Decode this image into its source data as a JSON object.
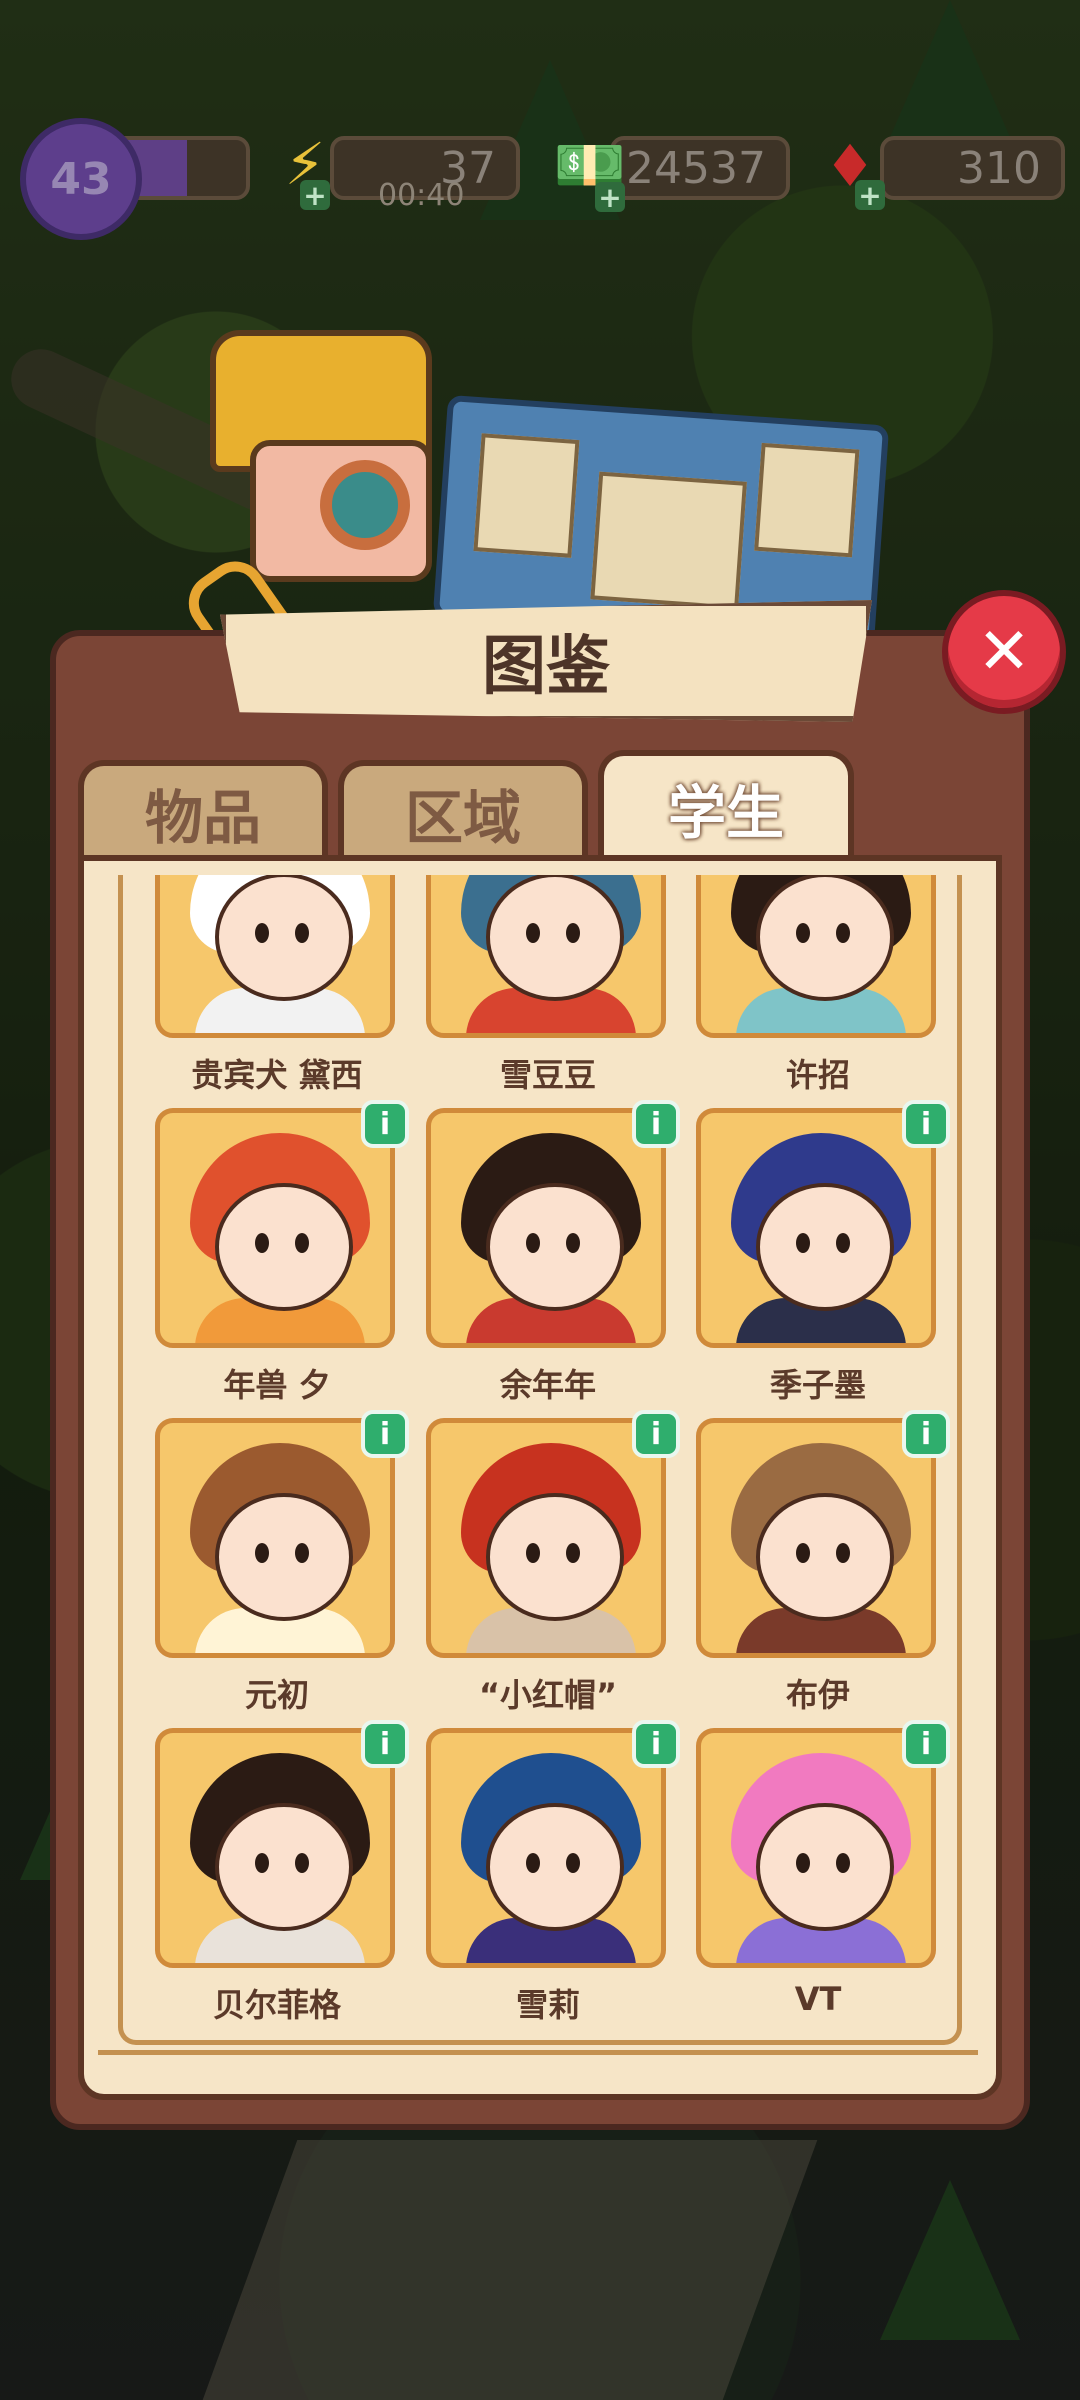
{
  "hud": {
    "level": "43",
    "xp_progress": 0.55,
    "energy": "37",
    "energy_timer": "00:40",
    "cash": "24537",
    "gems": "310"
  },
  "panel": {
    "title": "图鉴",
    "tabs": [
      {
        "label": "物品",
        "active": false
      },
      {
        "label": "区域",
        "active": false
      },
      {
        "label": "学生",
        "active": true
      }
    ]
  },
  "students": [
    {
      "name": "贵宾犬 黛西",
      "has_info": false,
      "hair": "#ffffff",
      "body": "#f2f2f2"
    },
    {
      "name": "雪豆豆",
      "has_info": false,
      "hair": "#3b6f8f",
      "body": "#d8442f"
    },
    {
      "name": "许招",
      "has_info": false,
      "hair": "#2b1b14",
      "body": "#7fc4c8"
    },
    {
      "name": "年兽 夕",
      "has_info": true,
      "hair": "#e0512d",
      "body": "#f19a3a"
    },
    {
      "name": "余年年",
      "has_info": true,
      "hair": "#2b1b14",
      "body": "#c93a2f"
    },
    {
      "name": "季子墨",
      "has_info": true,
      "hair": "#2f3a8c",
      "body": "#2b2f4a"
    },
    {
      "name": "元初",
      "has_info": true,
      "hair": "#9b5a2f",
      "body": "#fff4d6"
    },
    {
      "name": "“小红帽”",
      "has_info": true,
      "hair": "#c7321f",
      "body": "#d9c2a8"
    },
    {
      "name": "布伊",
      "has_info": true,
      "hair": "#9a6b42",
      "body": "#7a3a2a"
    },
    {
      "name": "贝尔菲格",
      "has_info": true,
      "hair": "#2b1b14",
      "body": "#e9e2da"
    },
    {
      "name": "雪莉",
      "has_info": true,
      "hair": "#1f4f8f",
      "body": "#3a2f7a"
    },
    {
      "name": "VT",
      "has_info": true,
      "hair": "#f17ac0",
      "body": "#8b6fd6"
    }
  ],
  "icons": {
    "close": "close-icon",
    "energy": "lightning-icon",
    "cash": "cash-icon",
    "gem": "ruby-icon",
    "info": "info-icon"
  }
}
